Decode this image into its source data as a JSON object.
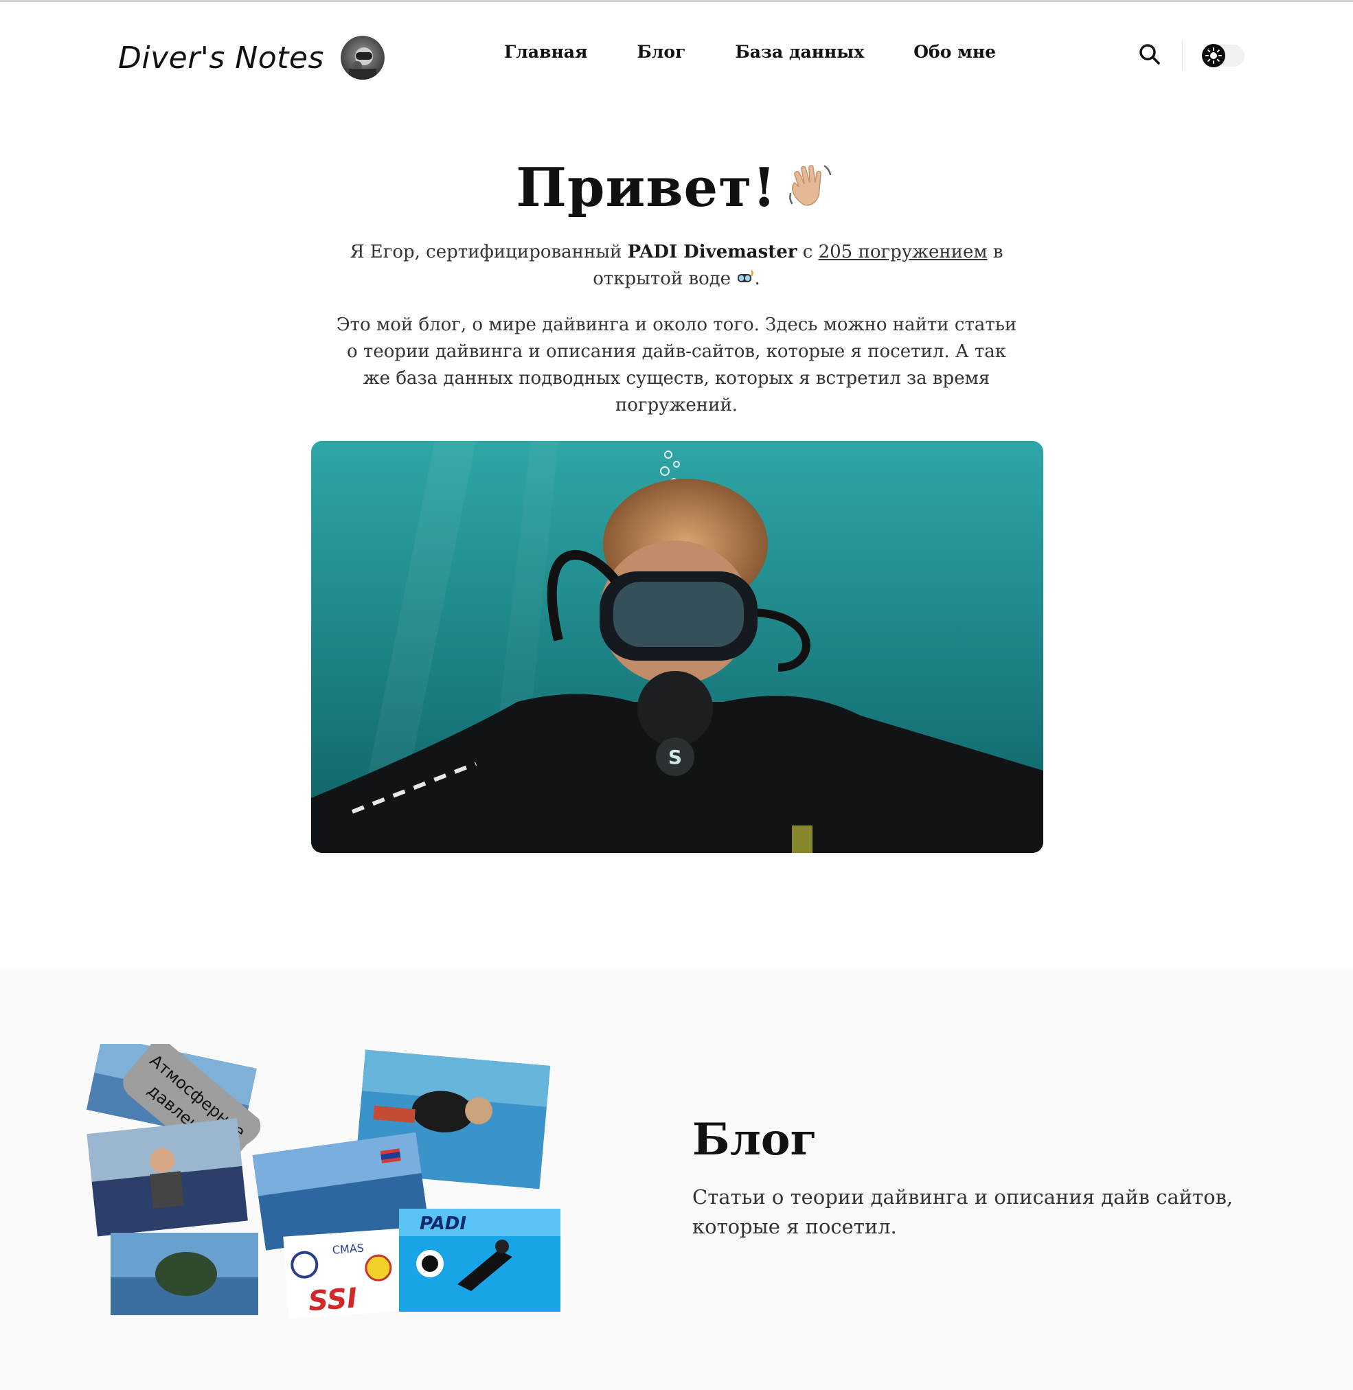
{
  "header": {
    "logo_text": "Diver's Notes",
    "nav": [
      {
        "label": "Главная"
      },
      {
        "label": "Блог"
      },
      {
        "label": "База данных"
      },
      {
        "label": "Обо мне"
      }
    ],
    "search_icon": "search-icon",
    "theme_toggle_icon": "sun-icon"
  },
  "hero": {
    "title": "Привет!",
    "title_emoji": "waving-hand-icon",
    "intro": {
      "part1": "Я Егор, сертифицированный ",
      "bold": "PADI Divemaster",
      "part2": " с ",
      "link": "205 погружением",
      "part3": " в открытой воде ",
      "emoji": "diving-mask-icon",
      "part4": "."
    },
    "about": "Это мой блог, о мире дайвинга и около того. Здесь можно найти статьи о теории дайвинга и описания дайв-сайтов, которые я посетил. А так же база данных подводных существ, которых я встретил за время погружений."
  },
  "blog": {
    "title": "Блог",
    "description": "Статьи о теории дайвинга и описания дайв сайтов, которые я посетил.",
    "collage": {
      "sticker_line1": "Атмосферное",
      "sticker_line2": "давление",
      "logo_padi": "PADI",
      "logo_cmas": "CMAS",
      "logo_ssi": "SSI"
    }
  },
  "colors": {
    "accent": "#111111",
    "section_bg": "#fafafa",
    "water": "#1f8a8a"
  }
}
